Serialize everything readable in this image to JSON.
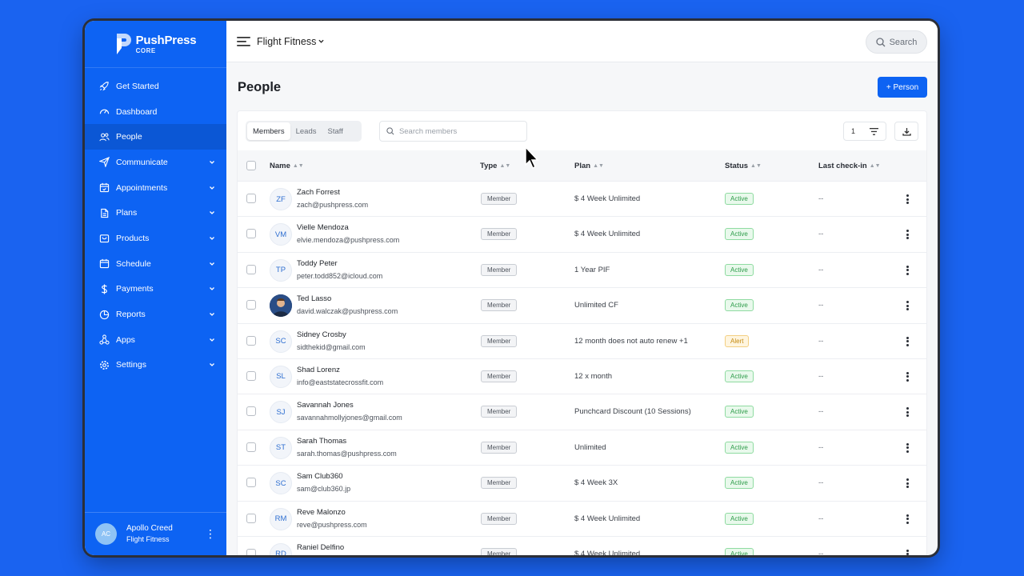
{
  "brand": {
    "name": "PushPress",
    "product": "CORE"
  },
  "sidebar": {
    "items": [
      {
        "label": "Get Started",
        "icon": "rocket-icon",
        "expandable": false,
        "active": false
      },
      {
        "label": "Dashboard",
        "icon": "gauge-icon",
        "expandable": false,
        "active": false
      },
      {
        "label": "People",
        "icon": "people-icon",
        "expandable": false,
        "active": true
      },
      {
        "label": "Communicate",
        "icon": "send-icon",
        "expandable": true,
        "active": false
      },
      {
        "label": "Appointments",
        "icon": "calendar-check-icon",
        "expandable": true,
        "active": false
      },
      {
        "label": "Plans",
        "icon": "document-icon",
        "expandable": true,
        "active": false
      },
      {
        "label": "Products",
        "icon": "bag-icon",
        "expandable": true,
        "active": false
      },
      {
        "label": "Schedule",
        "icon": "calendar-icon",
        "expandable": true,
        "active": false
      },
      {
        "label": "Payments",
        "icon": "dollar-icon",
        "expandable": true,
        "active": false
      },
      {
        "label": "Reports",
        "icon": "pie-chart-icon",
        "expandable": true,
        "active": false
      },
      {
        "label": "Apps",
        "icon": "apps-icon",
        "expandable": true,
        "active": false
      },
      {
        "label": "Settings",
        "icon": "gear-icon",
        "expandable": true,
        "active": false
      }
    ],
    "user": {
      "initials": "AC",
      "name": "Apollo Creed",
      "gym": "Flight Fitness"
    }
  },
  "topbar": {
    "gym": "Flight Fitness",
    "search_label": "Search"
  },
  "page": {
    "title": "People",
    "add_button": "+ Person"
  },
  "filters": {
    "tabs": [
      "Members",
      "Leads",
      "Staff"
    ],
    "active_tab": "Members",
    "search_placeholder": "Search members",
    "filter_count": "1"
  },
  "table": {
    "columns": [
      "Name",
      "Type",
      "Plan",
      "Status",
      "Last check-in"
    ],
    "rows": [
      {
        "initials": "ZF",
        "name": "Zach Forrest",
        "email": "zach@pushpress.com",
        "type": "Member",
        "plan": "$ 4 Week Unlimited",
        "status": "Active",
        "checkin": "--"
      },
      {
        "initials": "VM",
        "name": "Vielle Mendoza",
        "email": "elvie.mendoza@pushpress.com",
        "type": "Member",
        "plan": "$ 4 Week Unlimited",
        "status": "Active",
        "checkin": "--"
      },
      {
        "initials": "TP",
        "name": "Toddy Peter",
        "email": "peter.todd852@icloud.com",
        "type": "Member",
        "plan": "1 Year PIF",
        "status": "Active",
        "checkin": "--"
      },
      {
        "initials": "",
        "name": "Ted Lasso",
        "email": "david.walczak@pushpress.com",
        "type": "Member",
        "plan": "Unlimited CF",
        "status": "Active",
        "checkin": "--",
        "photo": true
      },
      {
        "initials": "SC",
        "name": "Sidney Crosby",
        "email": "sidthekid@gmail.com",
        "type": "Member",
        "plan": "12 month does not auto renew +1",
        "status": "Alert",
        "checkin": "--"
      },
      {
        "initials": "SL",
        "name": "Shad Lorenz",
        "email": "info@eaststatecrossfit.com",
        "type": "Member",
        "plan": "12 x month",
        "status": "Active",
        "checkin": "--"
      },
      {
        "initials": "SJ",
        "name": "Savannah Jones",
        "email": "savannahmollyjones@gmail.com",
        "type": "Member",
        "plan": "Punchcard Discount (10 Sessions)",
        "status": "Active",
        "checkin": "--"
      },
      {
        "initials": "ST",
        "name": "Sarah Thomas",
        "email": "sarah.thomas@pushpress.com",
        "type": "Member",
        "plan": "Unlimited",
        "status": "Active",
        "checkin": "--"
      },
      {
        "initials": "SC",
        "name": "Sam Club360",
        "email": "sam@club360.jp",
        "type": "Member",
        "plan": "$ 4 Week 3X",
        "status": "Active",
        "checkin": "--"
      },
      {
        "initials": "RM",
        "name": "Reve Malonzo",
        "email": "reve@pushpress.com",
        "type": "Member",
        "plan": "$ 4 Week Unlimited",
        "status": "Active",
        "checkin": "--"
      },
      {
        "initials": "RD",
        "name": "Raniel Delfino",
        "email": "",
        "type": "Member",
        "plan": "$ 4 Week Unlimited",
        "status": "Active",
        "checkin": "--"
      }
    ]
  },
  "colors": {
    "brand_blue": "#0d63f3",
    "background": "#1a63f0",
    "active_green": "#2e9c4a",
    "alert_amber": "#c48a10"
  }
}
